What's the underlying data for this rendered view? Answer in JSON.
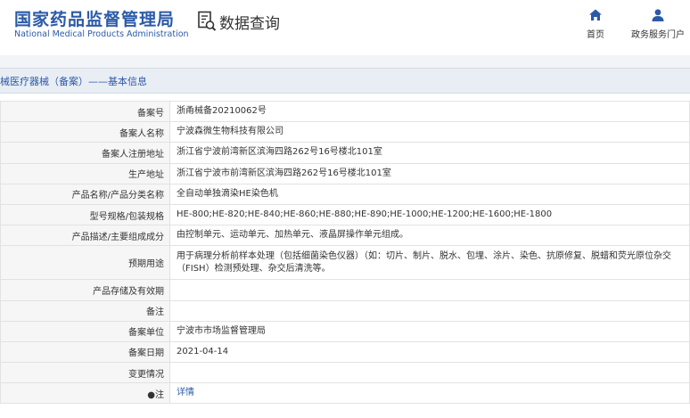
{
  "header": {
    "logo_cn": "国家药品监督管理局",
    "logo_en": "National Medical Products Administration",
    "query_label": "数据查询",
    "nav": {
      "home_label": "首页",
      "service_label": "政务服务门户"
    }
  },
  "section": {
    "title": "械医疗器械（备案）——基本信息"
  },
  "rows": [
    {
      "label": "备案号",
      "value": "浙甬械备20210062号"
    },
    {
      "label": "备案人名称",
      "value": "宁波森微生物科技有限公司"
    },
    {
      "label": "备案人注册地址",
      "value": "浙江省宁波前湾新区滨海四路262号16号楼北101室"
    },
    {
      "label": "生产地址",
      "value": "浙江省宁波市前湾新区滨海四路262号16号楼北101室"
    },
    {
      "label": "产品名称/产品分类名称",
      "value": "全自动单独滴染HE染色机"
    },
    {
      "label": "型号规格/包装规格",
      "value": "HE-800;HE-820;HE-840;HE-860;HE-880;HE-890;HE-1000;HE-1200;HE-1600;HE-1800"
    },
    {
      "label": "产品描述/主要组成成分",
      "value": "由控制单元、运动单元、加热单元、液晶屏操作单元组成。"
    },
    {
      "label": "预期用途",
      "value": "用于病理分析前样本处理（包括细菌染色仪器）（如：切片、制片、脱水、包埋、涂片、染色、抗原修复、脱蜡和荧光原位杂交（FISH）检测预处理、杂交后清洗等。"
    },
    {
      "label": "产品存储及有效期",
      "value": ""
    },
    {
      "label": "备注",
      "value": ""
    },
    {
      "label": "备案单位",
      "value": "宁波市市场监督管理局"
    },
    {
      "label": "备案日期",
      "value": "2021-04-14"
    },
    {
      "label": "变更情况",
      "value": ""
    },
    {
      "label": "●注",
      "value": "详情"
    }
  ],
  "colors": {
    "brand_blue": "#2b5aa8",
    "label_bg": "#f6f6f6",
    "section_bg": "#e9eef5"
  },
  "icons": {
    "home": "home-icon",
    "user": "user-icon",
    "query": "document-search-icon"
  }
}
